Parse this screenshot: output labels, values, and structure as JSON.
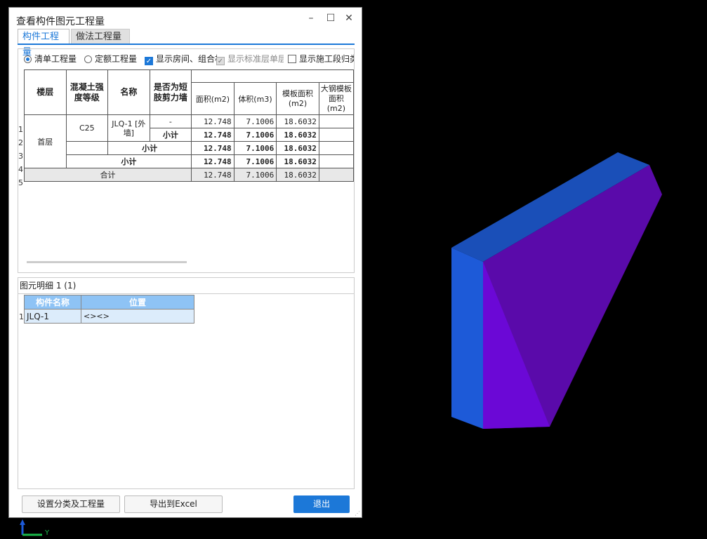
{
  "window": {
    "title": "查看构件图元工程量"
  },
  "tabs": [
    {
      "label": "构件工程量"
    },
    {
      "label": "做法工程量"
    }
  ],
  "options": {
    "qingdan": "清单工程量",
    "dinge": "定额工程量",
    "show_rooms": "显示房间、组合构件量",
    "show_std": "显示标准层单层量",
    "show_stage": "显示施工段归类"
  },
  "table": {
    "headers": [
      "楼层",
      "混凝土强度等级",
      "名称",
      "是否为短肢剪力墙",
      "面积(m2)",
      "体积(m3)",
      "模板面积(m2)",
      "大钢模板面积(m2)"
    ],
    "row_numbers": [
      "1",
      "2",
      "3",
      "4",
      "5"
    ],
    "floor": "首层",
    "grade": "C25",
    "name": "JLQ-1 [外墙]",
    "short_wall": "-",
    "subtotal": "小计",
    "total": "合计",
    "area": "12.748",
    "volume": "7.1006",
    "formwork": "18.6032"
  },
  "detail": {
    "label": "图元明细  1 (1)",
    "headers": [
      "构件名称",
      "位置"
    ],
    "row_number": "1",
    "rows": [
      {
        "name": "JLQ-1",
        "position": "<><>"
      }
    ]
  },
  "buttons": {
    "settings": "设置分类及工程量",
    "export": "导出到Excel",
    "exit": "退出"
  },
  "axis": {
    "y_label": "Y"
  },
  "colors": {
    "accent": "#1c78d8",
    "wall_top": "#1a4fb8",
    "wall_side": "#1d5ad8",
    "wall_front": "#5a0aaa"
  }
}
